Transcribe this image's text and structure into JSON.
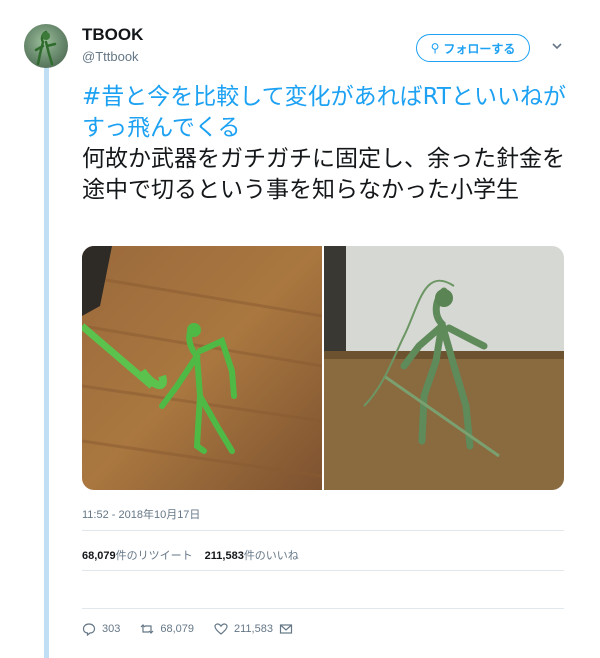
{
  "user": {
    "name": "TBOOK",
    "handle": "@Tttbook"
  },
  "follow_button": {
    "label": "フォローする"
  },
  "tweet": {
    "hashtag": "#昔と今を比較して変化があればRTといいねがすっ飛んでくる",
    "text": "何故か武器をガチガチに固定し、余った針金を途中で切るという事を知らなかった小学生",
    "timestamp": "11:52 - 2018年10月17日"
  },
  "stats": {
    "retweets_count": "68,079",
    "retweets_label": "件のリツイート",
    "likes_count": "211,583",
    "likes_label": "件のいいね"
  },
  "actions": {
    "replies": "303",
    "retweets": "68,079",
    "likes": "211,583"
  },
  "colors": {
    "accent": "#1da1f2",
    "text": "#14171a",
    "muted": "#657786",
    "thread_line": "#c0def4"
  }
}
